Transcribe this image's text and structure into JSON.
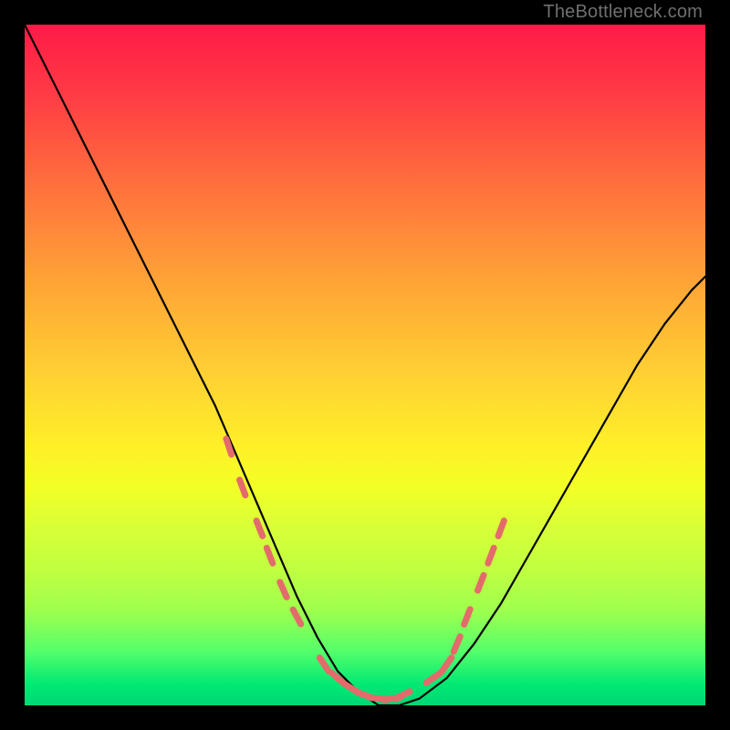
{
  "attribution": "TheBottleneck.com",
  "chart_data": {
    "type": "line",
    "title": "",
    "xlabel": "",
    "ylabel": "",
    "xlim": [
      0,
      100
    ],
    "ylim": [
      0,
      100
    ],
    "grid": false,
    "series": [
      {
        "name": "curve",
        "x": [
          0,
          4,
          8,
          12,
          16,
          20,
          24,
          28,
          31,
          34,
          37,
          40,
          43,
          46,
          49,
          52,
          55,
          58,
          62,
          66,
          70,
          74,
          78,
          82,
          86,
          90,
          94,
          98,
          100
        ],
        "y": [
          100,
          92,
          84,
          76,
          68,
          60,
          52,
          44,
          37,
          30,
          23,
          16,
          10,
          5,
          2,
          0,
          0,
          1,
          4,
          9,
          15,
          22,
          29,
          36,
          43,
          50,
          56,
          61,
          63
        ],
        "color": "#000000",
        "width": 2.2
      }
    ],
    "annotations": {
      "highlight_dots": {
        "color": "#e46b6b",
        "radius_px": 9,
        "stroke_px": 7,
        "points_xy": [
          [
            30,
            38
          ],
          [
            32,
            32
          ],
          [
            34.5,
            26
          ],
          [
            36,
            22
          ],
          [
            38,
            17
          ],
          [
            40,
            13
          ],
          [
            44,
            6
          ],
          [
            46,
            4
          ],
          [
            48,
            2.5
          ],
          [
            50,
            1.5
          ],
          [
            52,
            1
          ],
          [
            54,
            1
          ],
          [
            55.5,
            1.5
          ],
          [
            60,
            4
          ],
          [
            62,
            6
          ],
          [
            63.5,
            9
          ],
          [
            65,
            13
          ],
          [
            67,
            18
          ],
          [
            68.5,
            22
          ],
          [
            70,
            26
          ]
        ]
      }
    }
  }
}
